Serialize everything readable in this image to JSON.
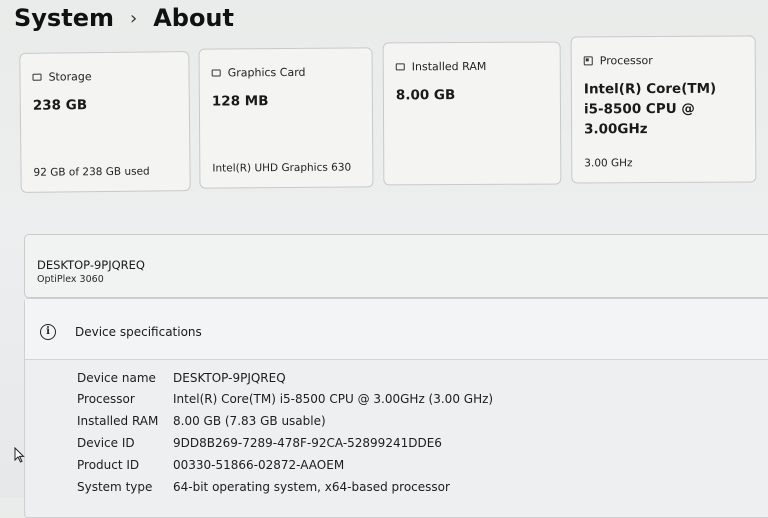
{
  "breadcrumb": {
    "parent": "System",
    "separator": "›",
    "current": "About"
  },
  "cards": {
    "storage": {
      "icon": "storage-drive-icon",
      "title": "Storage",
      "value": "238 GB",
      "sub": "92 GB of 238 GB used"
    },
    "graphics": {
      "icon": "graphics-card-icon",
      "title": "Graphics Card",
      "value": "128 MB",
      "sub": "Intel(R) UHD Graphics 630"
    },
    "ram": {
      "icon": "memory-icon",
      "title": "Installed RAM",
      "value": "8.00 GB"
    },
    "processor": {
      "icon": "processor-icon",
      "title": "Processor",
      "value": "Intel(R) Core(TM) i5-8500 CPU @ 3.00GHz",
      "sub": "3.00 GHz"
    }
  },
  "device": {
    "name": "DESKTOP-9PJQREQ",
    "model": "OptiPlex 3060"
  },
  "specs": {
    "icon": "info-icon",
    "title": "Device specifications",
    "rows": [
      {
        "label": "Device name",
        "value": "DESKTOP-9PJQREQ"
      },
      {
        "label": "Processor",
        "value": "Intel(R) Core(TM) i5-8500 CPU @ 3.00GHz (3.00 GHz)"
      },
      {
        "label": "Installed RAM",
        "value": "8.00 GB (7.83 GB usable)"
      },
      {
        "label": "Device ID",
        "value": "9DD8B269-7289-478F-92CA-52899241DDE6"
      },
      {
        "label": "Product ID",
        "value": "00330-51866-02872-AAOEM"
      },
      {
        "label": "System type",
        "value": "64-bit operating system, x64-based processor"
      }
    ]
  }
}
